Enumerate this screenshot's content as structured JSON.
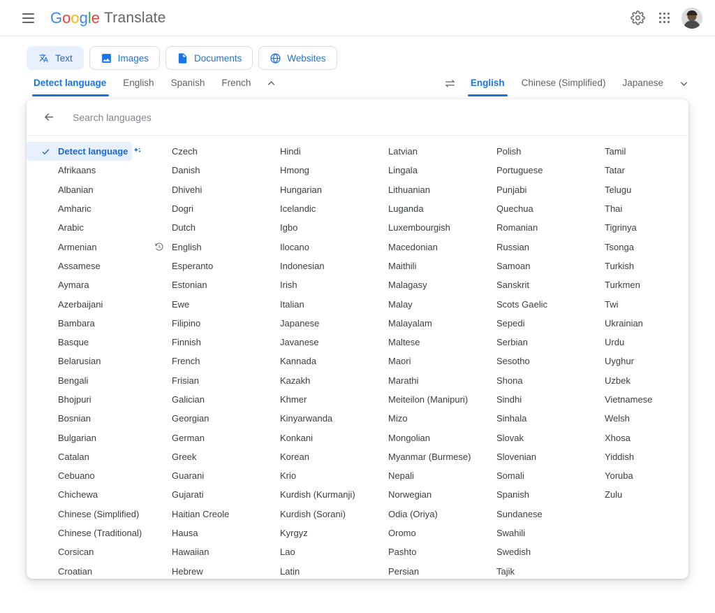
{
  "header": {
    "menu_icon": "hamburger-icon",
    "brand_google": "Google",
    "brand_product": "Translate",
    "settings_icon": "gear-icon",
    "apps_icon": "google-apps-icon",
    "avatar_icon": "user-avatar"
  },
  "modes": [
    {
      "label": "Text",
      "icon": "translate-text-icon",
      "active": true
    },
    {
      "label": "Images",
      "icon": "image-icon",
      "active": false
    },
    {
      "label": "Documents",
      "icon": "document-icon",
      "active": false
    },
    {
      "label": "Websites",
      "icon": "globe-icon",
      "active": false
    }
  ],
  "source_tabs": [
    {
      "label": "Detect language",
      "active": true
    },
    {
      "label": "English",
      "active": false
    },
    {
      "label": "Spanish",
      "active": false
    },
    {
      "label": "French",
      "active": false
    }
  ],
  "source_chevron_icon": "chevron-up-icon",
  "swap_icon": "swap-languages-icon",
  "target_tabs": [
    {
      "label": "English",
      "active": true
    },
    {
      "label": "Chinese (Simplified)",
      "active": false
    },
    {
      "label": "Japanese",
      "active": false
    }
  ],
  "target_chevron_icon": "chevron-down-icon",
  "panel": {
    "back_icon": "back-arrow-icon",
    "search_placeholder": "Search languages",
    "search_value": "",
    "columns": [
      [
        {
          "label": "Detect language",
          "selected": true,
          "check": true,
          "sparkle": true
        },
        {
          "label": "Afrikaans"
        },
        {
          "label": "Albanian"
        },
        {
          "label": "Amharic"
        },
        {
          "label": "Arabic"
        },
        {
          "label": "Armenian"
        },
        {
          "label": "Assamese"
        },
        {
          "label": "Aymara"
        },
        {
          "label": "Azerbaijani"
        },
        {
          "label": "Bambara"
        },
        {
          "label": "Basque"
        },
        {
          "label": "Belarusian"
        },
        {
          "label": "Bengali"
        },
        {
          "label": "Bhojpuri"
        },
        {
          "label": "Bosnian"
        },
        {
          "label": "Bulgarian"
        },
        {
          "label": "Catalan"
        },
        {
          "label": "Cebuano"
        },
        {
          "label": "Chichewa"
        },
        {
          "label": "Chinese (Simplified)"
        },
        {
          "label": "Chinese (Traditional)"
        },
        {
          "label": "Corsican"
        },
        {
          "label": "Croatian"
        }
      ],
      [
        {
          "label": "Czech"
        },
        {
          "label": "Danish"
        },
        {
          "label": "Dhivehi"
        },
        {
          "label": "Dogri"
        },
        {
          "label": "Dutch"
        },
        {
          "label": "English",
          "history": true
        },
        {
          "label": "Esperanto"
        },
        {
          "label": "Estonian"
        },
        {
          "label": "Ewe"
        },
        {
          "label": "Filipino"
        },
        {
          "label": "Finnish"
        },
        {
          "label": "French"
        },
        {
          "label": "Frisian"
        },
        {
          "label": "Galician"
        },
        {
          "label": "Georgian"
        },
        {
          "label": "German"
        },
        {
          "label": "Greek"
        },
        {
          "label": "Guarani"
        },
        {
          "label": "Gujarati"
        },
        {
          "label": "Haitian Creole"
        },
        {
          "label": "Hausa"
        },
        {
          "label": "Hawaiian"
        },
        {
          "label": "Hebrew"
        }
      ],
      [
        {
          "label": "Hindi"
        },
        {
          "label": "Hmong"
        },
        {
          "label": "Hungarian"
        },
        {
          "label": "Icelandic"
        },
        {
          "label": "Igbo"
        },
        {
          "label": "Ilocano"
        },
        {
          "label": "Indonesian"
        },
        {
          "label": "Irish"
        },
        {
          "label": "Italian"
        },
        {
          "label": "Japanese"
        },
        {
          "label": "Javanese"
        },
        {
          "label": "Kannada"
        },
        {
          "label": "Kazakh"
        },
        {
          "label": "Khmer"
        },
        {
          "label": "Kinyarwanda"
        },
        {
          "label": "Konkani"
        },
        {
          "label": "Korean"
        },
        {
          "label": "Krio"
        },
        {
          "label": "Kurdish (Kurmanji)"
        },
        {
          "label": "Kurdish (Sorani)"
        },
        {
          "label": "Kyrgyz"
        },
        {
          "label": "Lao"
        },
        {
          "label": "Latin"
        }
      ],
      [
        {
          "label": "Latvian"
        },
        {
          "label": "Lingala"
        },
        {
          "label": "Lithuanian"
        },
        {
          "label": "Luganda"
        },
        {
          "label": "Luxembourgish"
        },
        {
          "label": "Macedonian"
        },
        {
          "label": "Maithili"
        },
        {
          "label": "Malagasy"
        },
        {
          "label": "Malay"
        },
        {
          "label": "Malayalam"
        },
        {
          "label": "Maltese"
        },
        {
          "label": "Maori"
        },
        {
          "label": "Marathi"
        },
        {
          "label": "Meiteilon (Manipuri)"
        },
        {
          "label": "Mizo"
        },
        {
          "label": "Mongolian"
        },
        {
          "label": "Myanmar (Burmese)"
        },
        {
          "label": "Nepali"
        },
        {
          "label": "Norwegian"
        },
        {
          "label": "Odia (Oriya)"
        },
        {
          "label": "Oromo"
        },
        {
          "label": "Pashto"
        },
        {
          "label": "Persian"
        }
      ],
      [
        {
          "label": "Polish"
        },
        {
          "label": "Portuguese"
        },
        {
          "label": "Punjabi"
        },
        {
          "label": "Quechua"
        },
        {
          "label": "Romanian"
        },
        {
          "label": "Russian"
        },
        {
          "label": "Samoan"
        },
        {
          "label": "Sanskrit"
        },
        {
          "label": "Scots Gaelic"
        },
        {
          "label": "Sepedi"
        },
        {
          "label": "Serbian"
        },
        {
          "label": "Sesotho"
        },
        {
          "label": "Shona"
        },
        {
          "label": "Sindhi"
        },
        {
          "label": "Sinhala"
        },
        {
          "label": "Slovak"
        },
        {
          "label": "Slovenian"
        },
        {
          "label": "Somali"
        },
        {
          "label": "Spanish"
        },
        {
          "label": "Sundanese"
        },
        {
          "label": "Swahili"
        },
        {
          "label": "Swedish"
        },
        {
          "label": "Tajik"
        }
      ],
      [
        {
          "label": "Tamil"
        },
        {
          "label": "Tatar"
        },
        {
          "label": "Telugu"
        },
        {
          "label": "Thai"
        },
        {
          "label": "Tigrinya"
        },
        {
          "label": "Tsonga"
        },
        {
          "label": "Turkish"
        },
        {
          "label": "Turkmen"
        },
        {
          "label": "Twi"
        },
        {
          "label": "Ukrainian"
        },
        {
          "label": "Urdu"
        },
        {
          "label": "Uyghur"
        },
        {
          "label": "Uzbek"
        },
        {
          "label": "Vietnamese"
        },
        {
          "label": "Welsh"
        },
        {
          "label": "Xhosa"
        },
        {
          "label": "Yiddish"
        },
        {
          "label": "Yoruba"
        },
        {
          "label": "Zulu"
        }
      ]
    ]
  },
  "colors": {
    "accent": "#1a73e8",
    "accent_dark": "#1967d2",
    "selected_bg": "#e8f0fe",
    "text": "#3c4043",
    "muted": "#5f6368",
    "border": "#dadce0"
  }
}
